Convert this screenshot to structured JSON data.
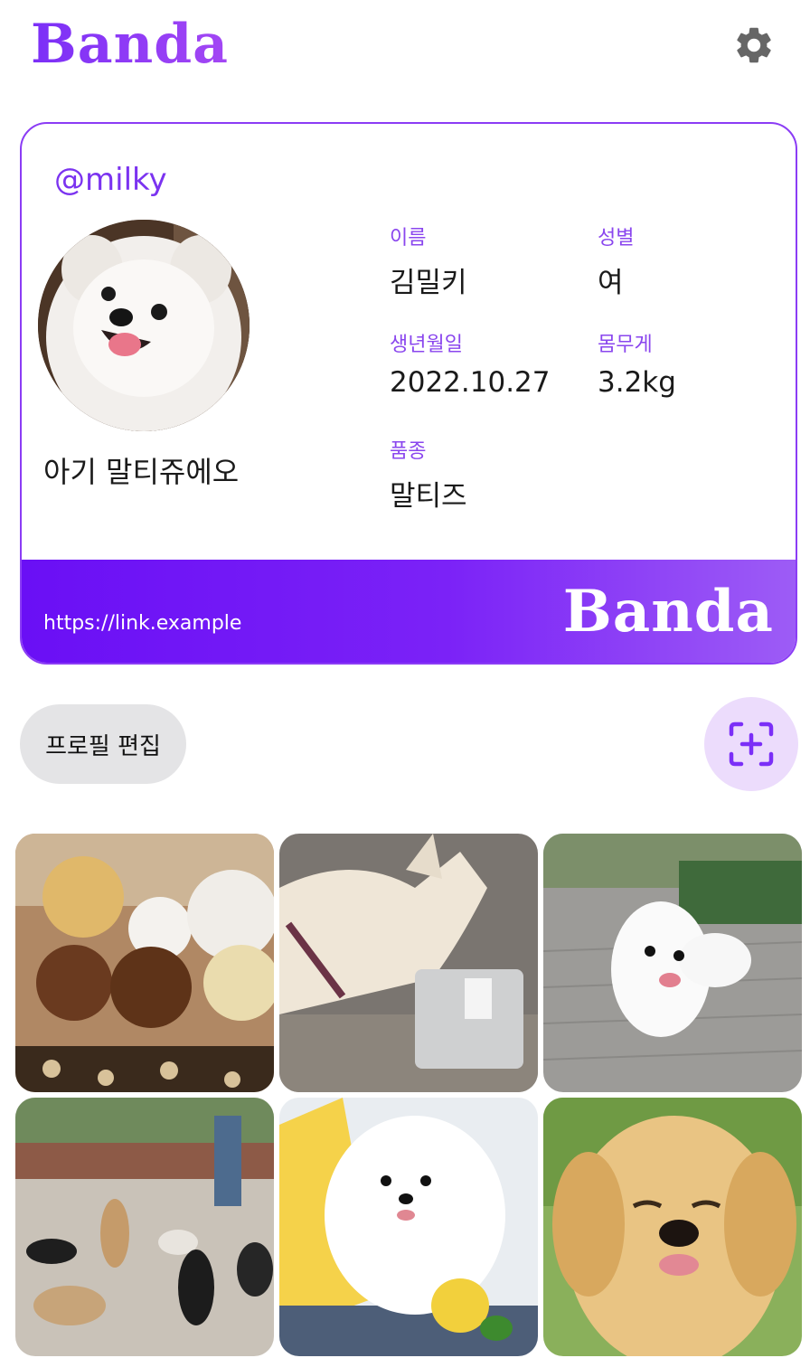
{
  "header": {
    "app_title": "Banda",
    "settings_icon": "gear-icon"
  },
  "profile": {
    "handle": "@milky",
    "bio": "아기 말티쥬에오",
    "fields": {
      "name_label": "이름",
      "name_value": "김밀키",
      "gender_label": "성별",
      "gender_value": "여",
      "birth_label": "생년월일",
      "birth_value": "2022.10.27",
      "weight_label": "몸무게",
      "weight_value": "3.2kg",
      "breed_label": "품종",
      "breed_value": "말티즈"
    },
    "footer": {
      "link": "https://link.example",
      "brand": "Banda"
    }
  },
  "actions": {
    "edit_label": "프로필 편집",
    "scan_icon": "scan-add-icon"
  },
  "gallery": {
    "photos": [
      {
        "subject": "stuffed-toys-photo"
      },
      {
        "subject": "dog-sniffing-photo"
      },
      {
        "subject": "running-white-puppy-photo"
      },
      {
        "subject": "dogs-in-yard-photo"
      },
      {
        "subject": "white-spitz-photo"
      },
      {
        "subject": "golden-puppy-photo"
      }
    ]
  },
  "colors": {
    "brand_purple": "#7b2ff7",
    "label_purple": "#8a46ee",
    "button_gray": "#e4e4e6",
    "scan_bg": "#ecdcfc"
  }
}
